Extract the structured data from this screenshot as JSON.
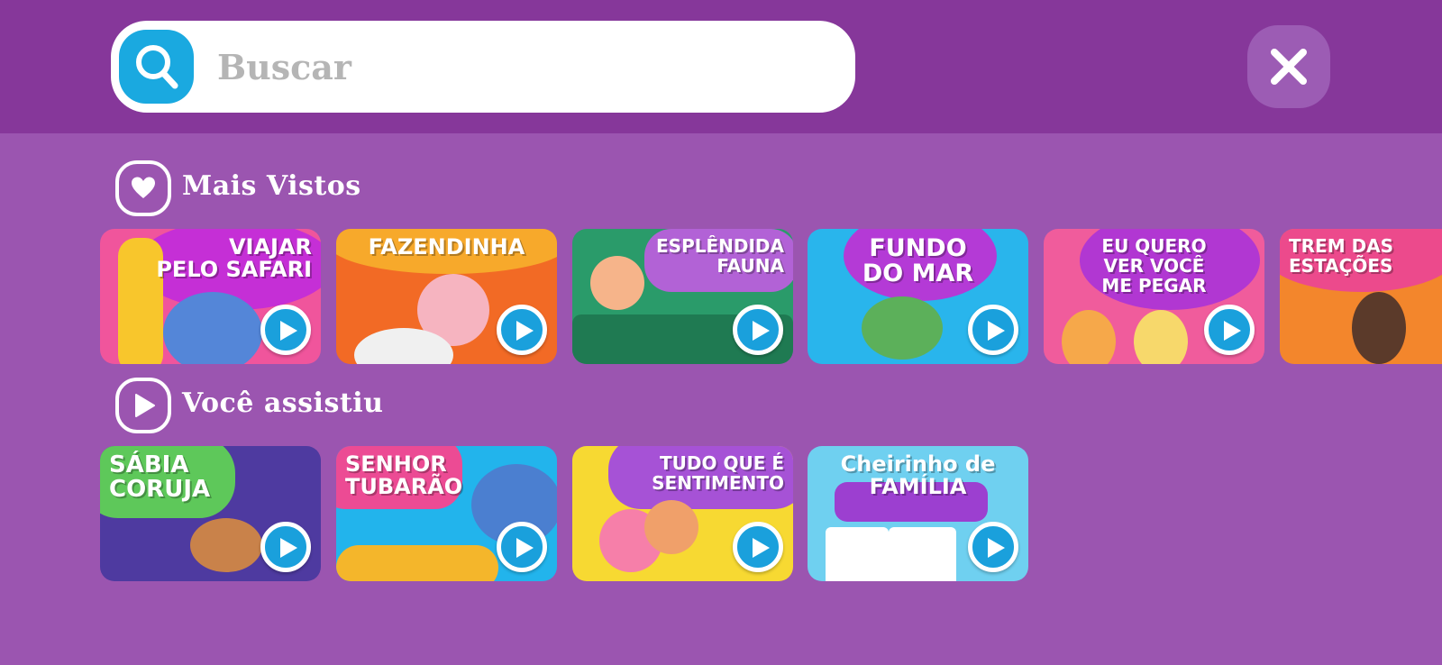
{
  "search": {
    "placeholder": "Buscar",
    "value": ""
  },
  "sections": {
    "most_viewed": {
      "title": "Mais Vistos"
    },
    "watched": {
      "title": "Você assistiu"
    }
  },
  "most_viewed": [
    {
      "title": "VIAJAR\nPELO SAFARI"
    },
    {
      "title": "FAZENDINHA"
    },
    {
      "title": "ESPLÊNDIDA\nFAUNA"
    },
    {
      "title": "FUNDO\nDO MAR"
    },
    {
      "title": "EU QUERO\nVER VOCÊ\nME PEGAR"
    },
    {
      "title": "TREM DAS\nESTAÇÕES"
    }
  ],
  "watched": [
    {
      "title": "SÁBIA\nCORUJA"
    },
    {
      "title": "SENHOR\nTUBARÃO"
    },
    {
      "title": "TUDO QUE É\nSENTIMENTO"
    },
    {
      "title": "Cheirinho de\nFAMÍLIA"
    }
  ],
  "colors": {
    "header_bg": "#86379a",
    "body_bg": "#9b55b0",
    "accent_blue": "#1aa9e0"
  }
}
